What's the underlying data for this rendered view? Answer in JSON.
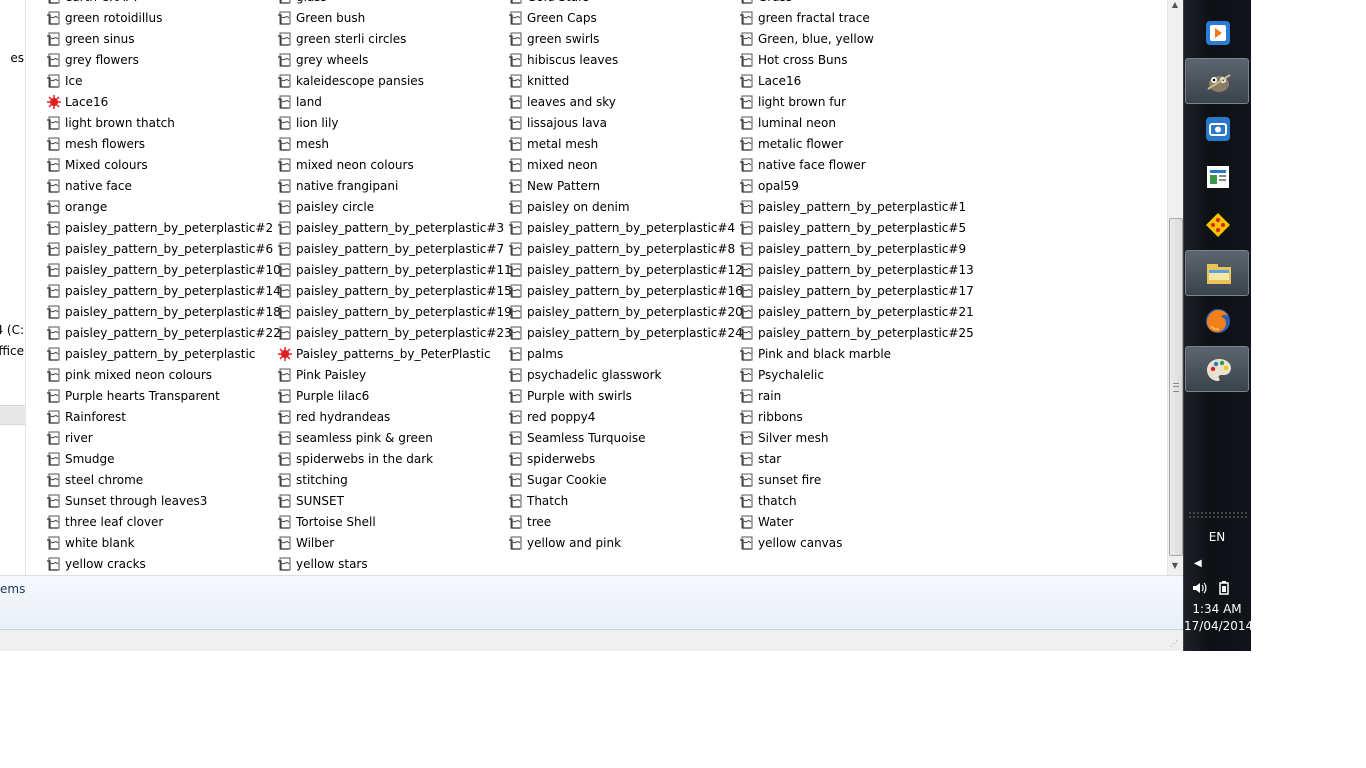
{
  "nav_fragments": [
    "es",
    "4 (C:",
    "ffice"
  ],
  "columns": [
    {
      "items": [
        {
          "label": "earth CRAFT"
        },
        {
          "label": "green  rotoidillus"
        },
        {
          "label": "green sinus"
        },
        {
          "label": "grey flowers"
        },
        {
          "label": "Ice"
        },
        {
          "label": "Lace16",
          "icon": "red-splat-icon"
        },
        {
          "label": "light brown thatch"
        },
        {
          "label": "mesh flowers"
        },
        {
          "label": "Mixed colours"
        },
        {
          "label": "native face"
        },
        {
          "label": "orange"
        },
        {
          "label": "paisley_pattern_by_peterplastic#2"
        },
        {
          "label": "paisley_pattern_by_peterplastic#6"
        },
        {
          "label": "paisley_pattern_by_peterplastic#10"
        },
        {
          "label": "paisley_pattern_by_peterplastic#14"
        },
        {
          "label": "paisley_pattern_by_peterplastic#18"
        },
        {
          "label": "paisley_pattern_by_peterplastic#22"
        },
        {
          "label": "paisley_pattern_by_peterplastic"
        },
        {
          "label": "pink mixed neon colours"
        },
        {
          "label": "Purple hearts Transparent"
        },
        {
          "label": "Rainforest"
        },
        {
          "label": "river"
        },
        {
          "label": "Smudge"
        },
        {
          "label": "steel chrome"
        },
        {
          "label": "Sunset through leaves3"
        },
        {
          "label": "three leaf clover"
        },
        {
          "label": "white blank"
        },
        {
          "label": "yellow cracks"
        }
      ]
    },
    {
      "items": [
        {
          "label": "glass"
        },
        {
          "label": "Green bush"
        },
        {
          "label": "green sterli circles"
        },
        {
          "label": "grey wheels"
        },
        {
          "label": "kaleidescope pansies"
        },
        {
          "label": "land"
        },
        {
          "label": "lion lily"
        },
        {
          "label": "mesh"
        },
        {
          "label": "mixed neon colours"
        },
        {
          "label": "native frangipani"
        },
        {
          "label": "paisley circle"
        },
        {
          "label": "paisley_pattern_by_peterplastic#3"
        },
        {
          "label": "paisley_pattern_by_peterplastic#7"
        },
        {
          "label": "paisley_pattern_by_peterplastic#11"
        },
        {
          "label": "paisley_pattern_by_peterplastic#15"
        },
        {
          "label": "paisley_pattern_by_peterplastic#19"
        },
        {
          "label": "paisley_pattern_by_peterplastic#23"
        },
        {
          "label": "Paisley_patterns_by_PeterPlastic",
          "icon": "red-splat-icon"
        },
        {
          "label": "Pink Paisley"
        },
        {
          "label": "Purple lilac6"
        },
        {
          "label": "red hydrandeas"
        },
        {
          "label": "seamless pink & green"
        },
        {
          "label": "spiderwebs in the dark"
        },
        {
          "label": "stitching"
        },
        {
          "label": "SUNSET"
        },
        {
          "label": "Tortoise Shell"
        },
        {
          "label": "Wilber"
        },
        {
          "label": "yellow stars"
        }
      ]
    },
    {
      "items": [
        {
          "label": "Gold Stars"
        },
        {
          "label": "Green Caps"
        },
        {
          "label": "green swirls"
        },
        {
          "label": "hibiscus leaves"
        },
        {
          "label": "knitted"
        },
        {
          "label": "leaves and sky"
        },
        {
          "label": "lissajous lava"
        },
        {
          "label": "metal mesh"
        },
        {
          "label": "mixed neon"
        },
        {
          "label": "New Pattern"
        },
        {
          "label": "paisley on denim"
        },
        {
          "label": "paisley_pattern_by_peterplastic#4"
        },
        {
          "label": "paisley_pattern_by_peterplastic#8"
        },
        {
          "label": "paisley_pattern_by_peterplastic#12"
        },
        {
          "label": "paisley_pattern_by_peterplastic#16"
        },
        {
          "label": "paisley_pattern_by_peterplastic#20"
        },
        {
          "label": "paisley_pattern_by_peterplastic#24"
        },
        {
          "label": "palms"
        },
        {
          "label": "psychadelic glasswork"
        },
        {
          "label": "Purple with swirls"
        },
        {
          "label": "red poppy4"
        },
        {
          "label": "Seamless Turquoise"
        },
        {
          "label": "spiderwebs"
        },
        {
          "label": "Sugar Cookie"
        },
        {
          "label": "Thatch"
        },
        {
          "label": "tree"
        },
        {
          "label": "yellow and pink"
        }
      ]
    },
    {
      "items": [
        {
          "label": "Grass"
        },
        {
          "label": "green fractal trace"
        },
        {
          "label": "Green, blue, yellow"
        },
        {
          "label": "Hot cross Buns"
        },
        {
          "label": "Lace16"
        },
        {
          "label": "light brown fur"
        },
        {
          "label": "luminal neon"
        },
        {
          "label": "metalic flower"
        },
        {
          "label": "native face flower"
        },
        {
          "label": "opal59"
        },
        {
          "label": "paisley_pattern_by_peterplastic#1"
        },
        {
          "label": "paisley_pattern_by_peterplastic#5"
        },
        {
          "label": "paisley_pattern_by_peterplastic#9"
        },
        {
          "label": "paisley_pattern_by_peterplastic#13"
        },
        {
          "label": "paisley_pattern_by_peterplastic#17"
        },
        {
          "label": "paisley_pattern_by_peterplastic#21"
        },
        {
          "label": "paisley_pattern_by_peterplastic#25"
        },
        {
          "label": "Pink and black marble"
        },
        {
          "label": "Psychalelic"
        },
        {
          "label": "rain"
        },
        {
          "label": "ribbons"
        },
        {
          "label": "Silver mesh"
        },
        {
          "label": "star"
        },
        {
          "label": "sunset fire"
        },
        {
          "label": "thatch"
        },
        {
          "label": "Water"
        },
        {
          "label": "yellow canvas"
        }
      ]
    }
  ],
  "details": {
    "item_count_text": "ems"
  },
  "taskbar": {
    "apps": [
      {
        "name": "media-player-icon",
        "active": false
      },
      {
        "name": "gimp-icon",
        "active": true
      },
      {
        "name": "camera-app-icon",
        "active": false
      },
      {
        "name": "news-app-icon",
        "active": false
      },
      {
        "name": "network-app-icon",
        "active": false
      },
      {
        "name": "file-explorer-icon",
        "active": true
      },
      {
        "name": "firefox-icon",
        "active": false
      },
      {
        "name": "paint-palette-icon",
        "active": true
      }
    ],
    "language": "EN",
    "time": "1:34 AM",
    "date": "17/04/2014"
  },
  "colors": {
    "accent_red": "#e02020",
    "taskbar_bg": "#111419"
  }
}
